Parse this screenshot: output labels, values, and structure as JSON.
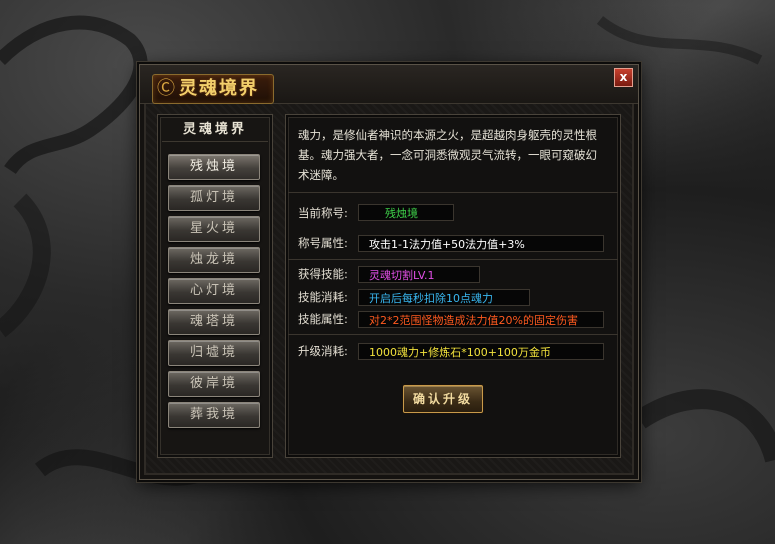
{
  "window": {
    "title": "灵魂境界",
    "close_label": "x"
  },
  "left": {
    "header": "灵魂境界",
    "realms": [
      "残烛境",
      "孤灯境",
      "星火境",
      "烛龙境",
      "心灯境",
      "魂塔境",
      "归墟境",
      "彼岸境",
      "葬我境"
    ]
  },
  "right": {
    "description": "魂力，是修仙者神识的本源之火，是超越肉身躯壳的灵性根基。魂力强大者，一念可洞悉微观灵气流转，一眼可窥破幻术迷障。",
    "current_title": {
      "label": "当前称号:",
      "value": "残烛境"
    },
    "title_attr": {
      "label": "称号属性:",
      "value": "攻击1-1法力值+50法力值+3%"
    },
    "skill": {
      "label": "获得技能:",
      "value": "灵魂切割LV.1"
    },
    "skill_cost": {
      "label": "技能消耗:",
      "value": "开启后每秒扣除10点魂力"
    },
    "skill_attr": {
      "label": "技能属性:",
      "value": "对2*2范围怪物造成法力值20%的固定伤害"
    },
    "upgrade_cost": {
      "label": "升级消耗:",
      "value": "1000魂力+修炼石*100+100万金币"
    },
    "confirm_label": "确认升级"
  },
  "colors": {
    "title_value": "#3fd24a",
    "attr_value": "#ffffff",
    "skill_value": "#e14fe6",
    "skill_cost_value": "#39b7f0",
    "skill_attr_value": "#ff5a1f",
    "upgrade_value": "#f2e23c"
  }
}
